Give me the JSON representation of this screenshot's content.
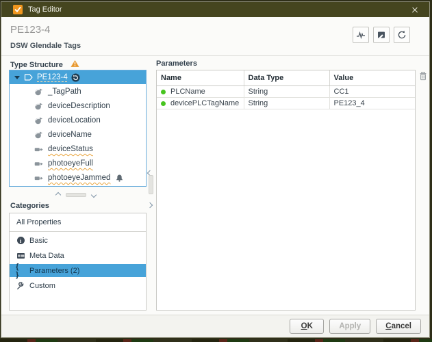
{
  "colors": {
    "titlebar_olive": "#45451f",
    "selection_blue": "#47a3d9",
    "warning_orange": "#e8982e",
    "app_icon_orange": "#f0961e",
    "param_green": "#47c41f"
  },
  "window": {
    "title": "Tag Editor"
  },
  "header": {
    "title": "PE123-4",
    "subtitle": "DSW Glendale Tags"
  },
  "type_structure": {
    "label": "Type Structure",
    "root": {
      "label": "PE123-4"
    },
    "children": [
      {
        "label": "_TagPath",
        "icon": "reference-tag-icon",
        "modified": false
      },
      {
        "label": "deviceDescription",
        "icon": "reference-tag-icon",
        "modified": false
      },
      {
        "label": "deviceLocation",
        "icon": "reference-tag-icon",
        "modified": false
      },
      {
        "label": "deviceName",
        "icon": "reference-tag-icon",
        "modified": false
      },
      {
        "label": "deviceStatus",
        "icon": "opc-tag-icon",
        "modified": true
      },
      {
        "label": "photoeyeFull",
        "icon": "opc-tag-icon",
        "modified": true
      },
      {
        "label": "photoeyeJammed",
        "icon": "opc-tag-icon",
        "modified": true,
        "alarm": true
      }
    ]
  },
  "categories": {
    "label": "Categories",
    "all_label": "All Properties",
    "items": [
      {
        "label": "Basic",
        "icon": "info-icon"
      },
      {
        "label": "Meta Data",
        "icon": "meta-data-icon"
      },
      {
        "label": "Parameters (2)",
        "icon": "braces-icon",
        "selected": true
      },
      {
        "label": "Custom",
        "icon": "wrench-icon"
      }
    ]
  },
  "icon_glyphs": {
    "info": "i",
    "braces": "{ }"
  },
  "parameters": {
    "label": "Parameters",
    "columns": [
      "Name",
      "Data Type",
      "Value"
    ],
    "rows": [
      {
        "name": "PLCName",
        "data_type": "String",
        "value": "CC1"
      },
      {
        "name": "devicePLCTagName",
        "data_type": "String",
        "value": "PE123_4"
      }
    ]
  },
  "footer": {
    "ok": "OK",
    "apply": "Apply",
    "cancel": "Cancel"
  }
}
